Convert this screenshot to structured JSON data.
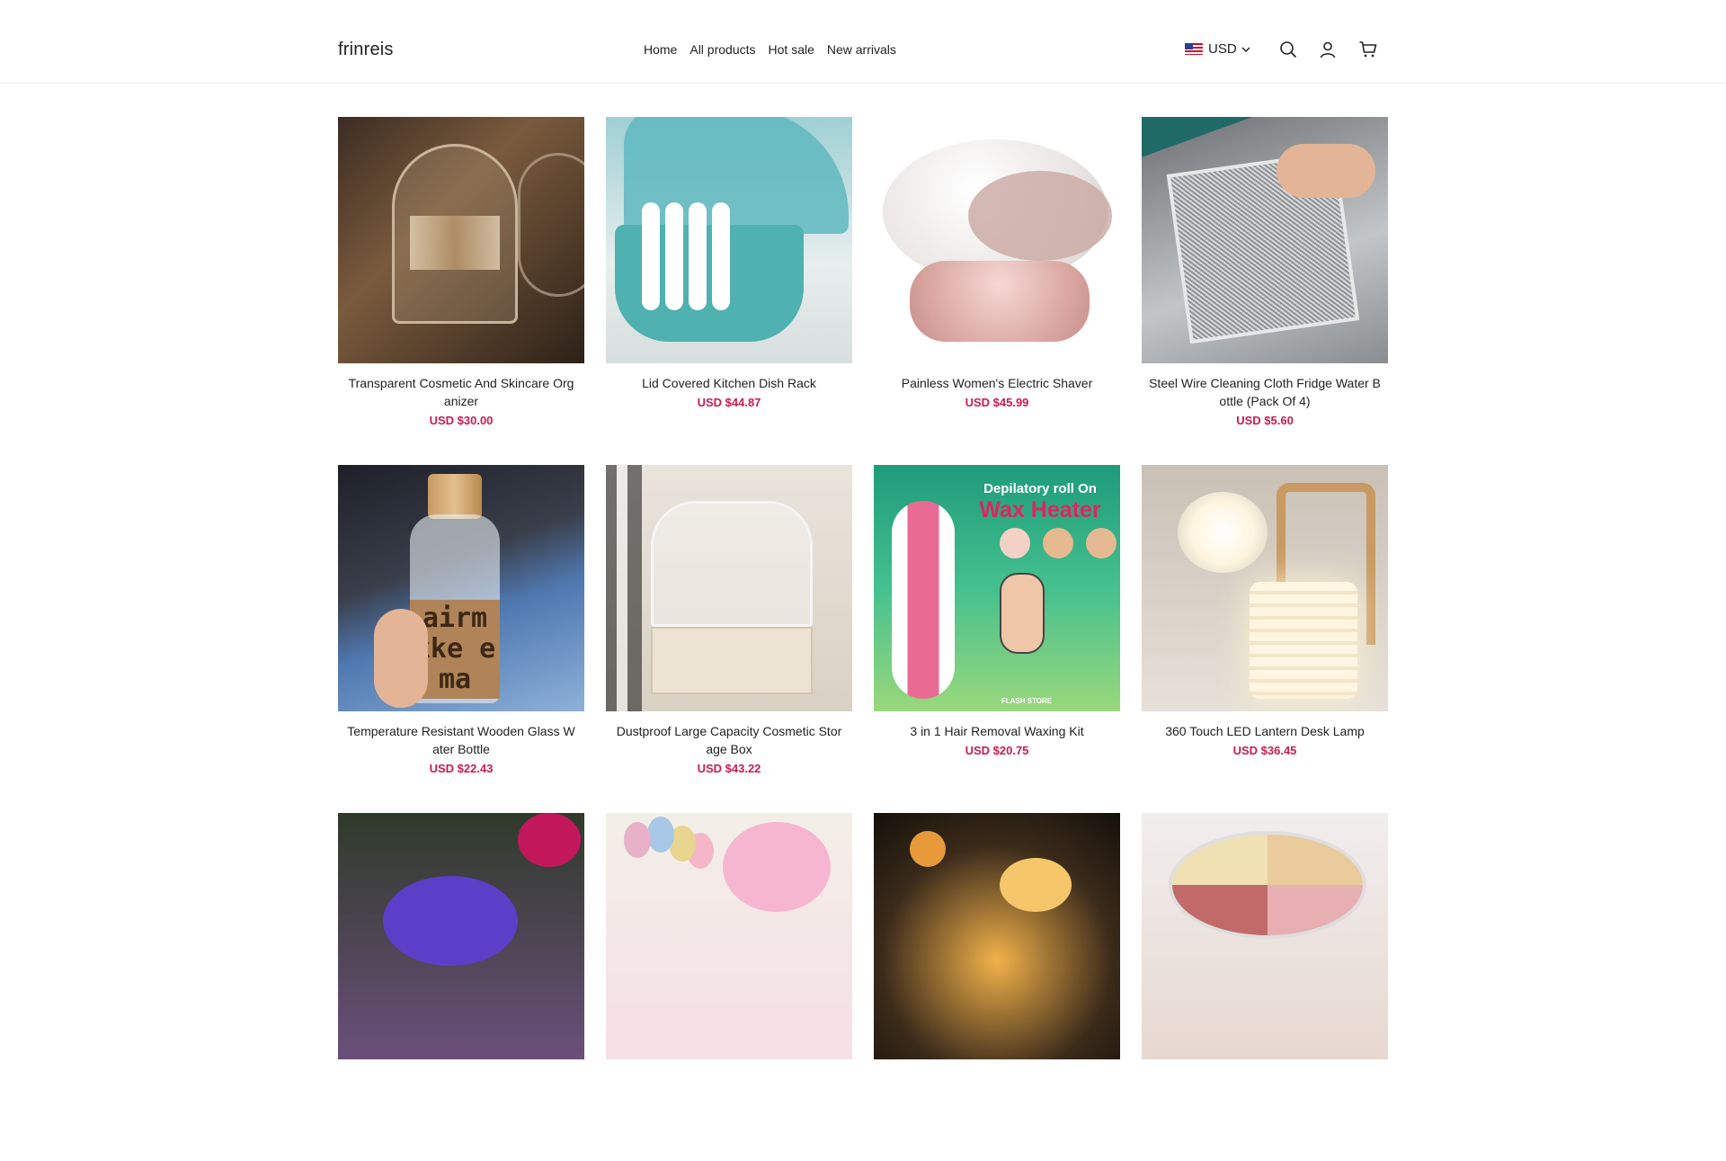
{
  "header": {
    "logo": "frinreis",
    "nav": [
      "Home",
      "All products",
      "Hot sale",
      "New arrivals"
    ],
    "currency": "USD",
    "icons": [
      "search-icon",
      "account-icon",
      "cart-icon"
    ]
  },
  "products": [
    {
      "title": "Transparent Cosmetic And Skincare Org anizer",
      "price": "USD $30.00"
    },
    {
      "title": "Lid Covered Kitchen Dish Rack",
      "price": "USD $44.87"
    },
    {
      "title": "Painless Women's Electric Shaver",
      "price": "USD $45.99"
    },
    {
      "title": "Steel Wire Cleaning Cloth Fridge Water Bottle (Pack Of 4)",
      "price": "USD $5.60"
    },
    {
      "title": "Temperature Resistant Wooden Glass W ater Bottle",
      "price": "USD $22.43"
    },
    {
      "title": "Dustproof Large Capacity Cosmetic Stor age Box",
      "price": "USD $43.22"
    },
    {
      "title": "3 in 1 Hair Removal Waxing Kit",
      "price": "USD $20.75"
    },
    {
      "title": "360 Touch LED Lantern Desk Lamp",
      "price": "USD $36.45"
    },
    {
      "title": "",
      "price": ""
    },
    {
      "title": "",
      "price": ""
    },
    {
      "title": "",
      "price": ""
    },
    {
      "title": "",
      "price": ""
    }
  ],
  "image_text": {
    "wax_line1": "Depilatory roll On",
    "wax_line2": "Wax Heater",
    "wax_brand": "FLASH STORE",
    "bottle_text": "airm kke ema"
  },
  "colors": {
    "price": "#c91c4f",
    "border": "#ececec"
  }
}
